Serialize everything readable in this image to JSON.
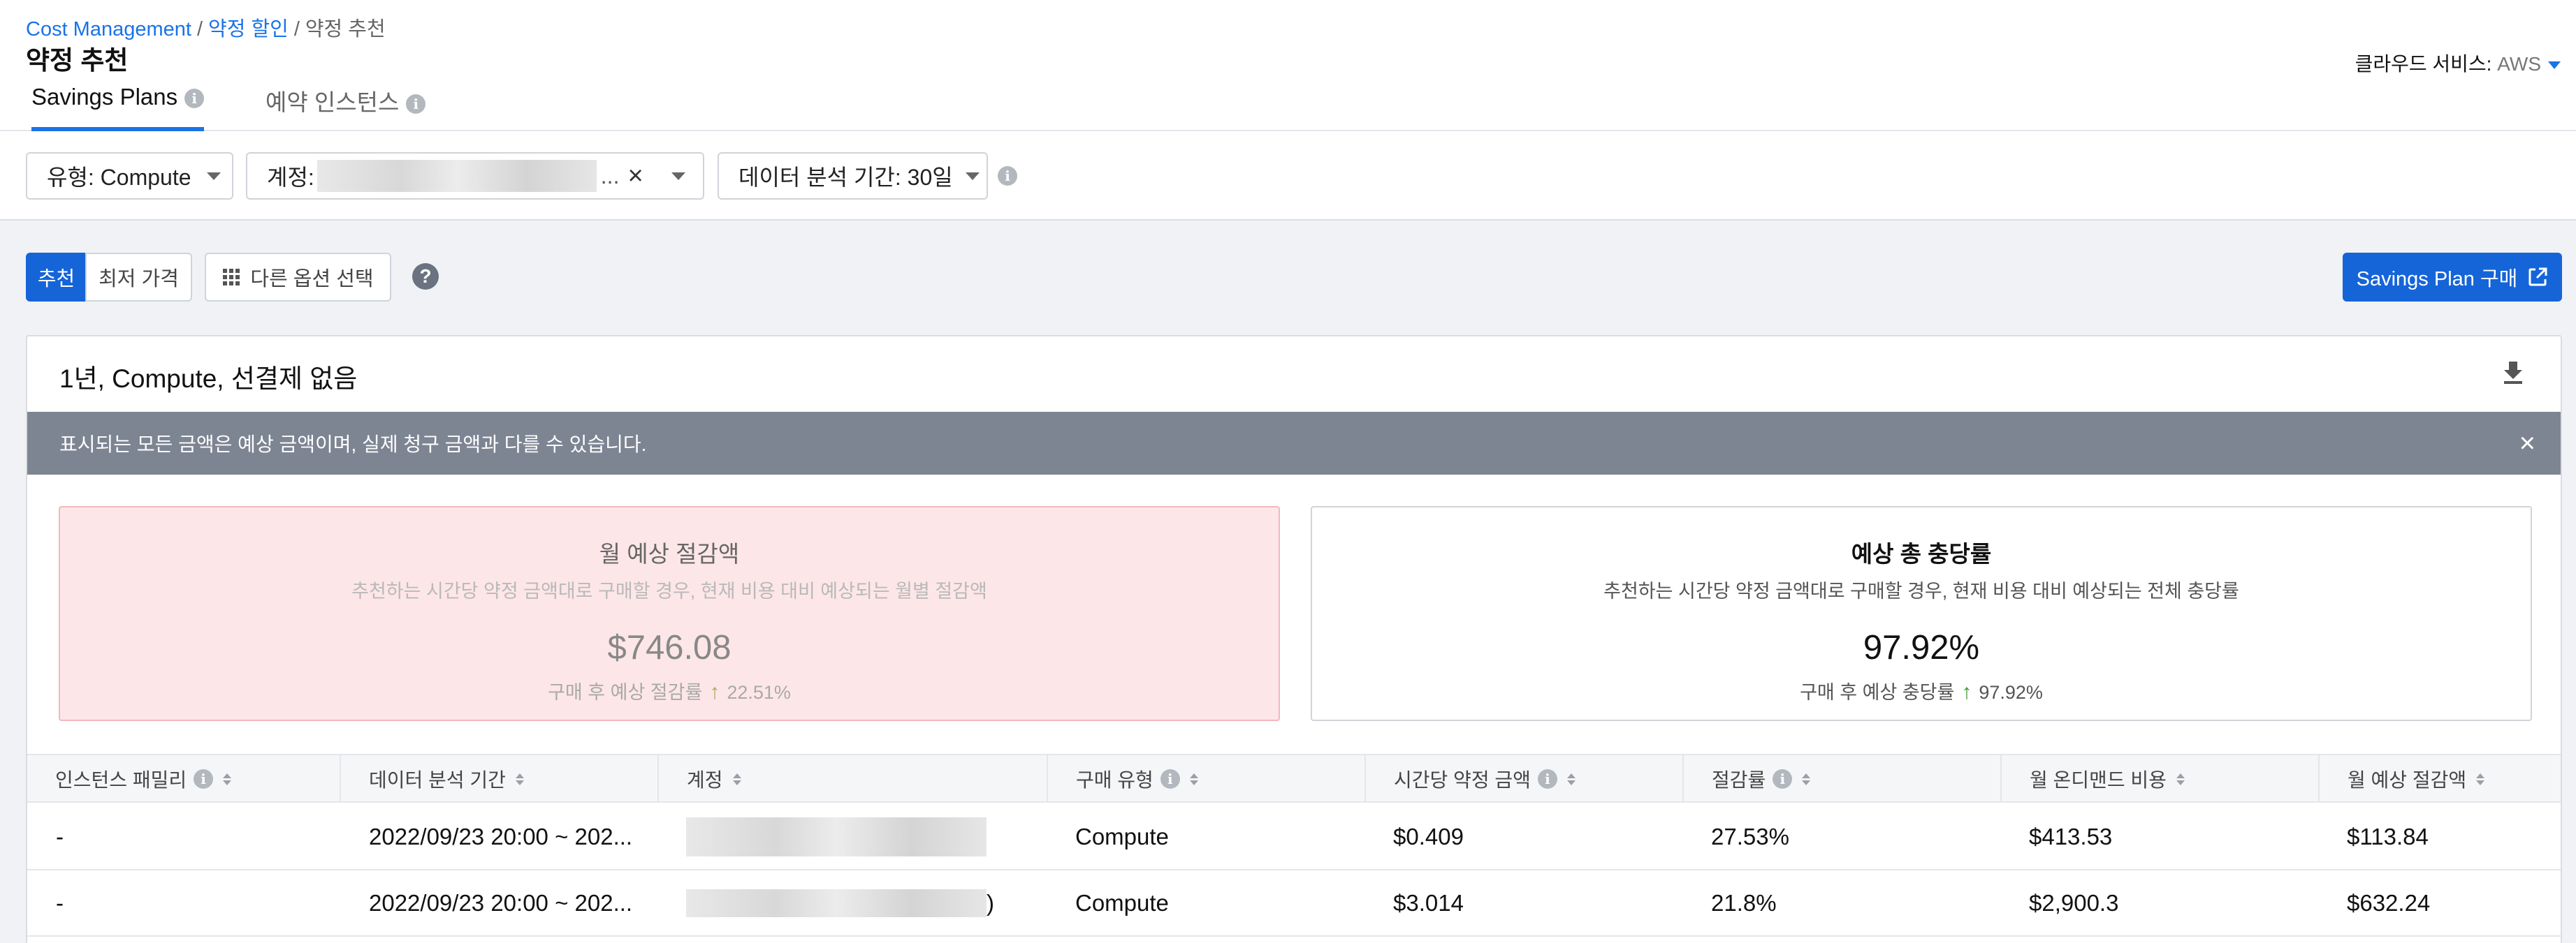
{
  "breadcrumb": [
    "Cost Management",
    "약정 할인",
    "약정 추천"
  ],
  "page_title": "약정 추천",
  "cloud_service": {
    "label": "클라우드 서비스:",
    "value": "AWS"
  },
  "tabs": [
    {
      "label": "Savings Plans",
      "active": true
    },
    {
      "label": "예약 인스턴스",
      "active": false
    }
  ],
  "filters": {
    "type": "유형: Compute",
    "account_label": "계정:",
    "account_ellipsis": "...",
    "clear_icon": "×",
    "period": "데이터 분석 기간: 30일"
  },
  "toolbar": {
    "segment": [
      "추천",
      "최저 가격"
    ],
    "other_options": "다른 옵션 선택",
    "help": "?",
    "buy": "Savings Plan 구매"
  },
  "card": {
    "title": "1년, Compute, 선결제 없음",
    "notice": "표시되는 모든 금액은 예상 금액이며, 실제 청구 금액과 다를 수 있습니다.",
    "close": "×"
  },
  "stats": [
    {
      "title": "월 예상 절감액",
      "subtitle": "추천하는 시간당 약정 금액대로 구매할 경우, 현재 비용 대비 예상되는 월별 절감액",
      "value": "$746.08",
      "foot_label": "구매 후 예상 절감률",
      "foot_value": "22.51%"
    },
    {
      "title": "예상 총 충당률",
      "subtitle": "추천하는 시간당 약정 금액대로 구매할 경우, 현재 비용 대비 예상되는 전체 충당률",
      "value": "97.92%",
      "foot_label": "구매 후 예상 충당률",
      "foot_value": "97.92%"
    }
  ],
  "table": {
    "columns": [
      "인스턴스 패밀리",
      "데이터 분석 기간",
      "계정",
      "구매 유형",
      "시간당 약정 금액",
      "절감률",
      "월 온디맨드 비용",
      "월 예상 절감액"
    ],
    "rows": [
      {
        "family": "-",
        "period": "2022/09/23 20:00 ~ 202...",
        "account_suffix": "",
        "type": "Compute",
        "hourly": "$0.409",
        "rate": "27.53%",
        "ondemand": "$413.53",
        "savings": "$113.84"
      },
      {
        "family": "-",
        "period": "2022/09/23 20:00 ~ 202...",
        "account_suffix": ")",
        "type": "Compute",
        "hourly": "$3.014",
        "rate": "21.8%",
        "ondemand": "$2,900.3",
        "savings": "$632.24"
      }
    ]
  },
  "colors": {
    "accent": "#1565d8",
    "banner": "#7d8593",
    "pink_card": "#fde6e8"
  }
}
